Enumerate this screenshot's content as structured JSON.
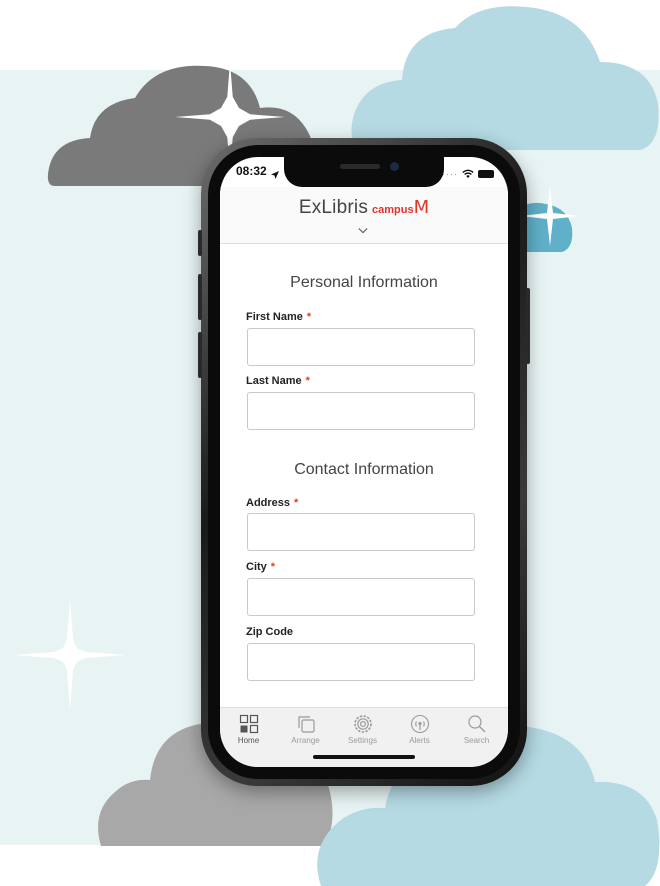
{
  "status_bar": {
    "time": "08:32"
  },
  "header": {
    "logo_ex": "ExLibris",
    "logo_campus": "campus",
    "logo_m": "M"
  },
  "form": {
    "personal_title": "Personal Information",
    "contact_title": "Contact Information",
    "required_marker": "*",
    "fields": [
      {
        "label": "First Name",
        "value": "",
        "required": true
      },
      {
        "label": "Last Name",
        "value": "",
        "required": true
      },
      {
        "label": "Address",
        "value": "",
        "required": true
      },
      {
        "label": "City",
        "value": "",
        "required": true
      },
      {
        "label": "Zip Code",
        "value": "",
        "required": false
      }
    ]
  },
  "tabs": [
    {
      "label": "Home",
      "icon": "home-grid-icon",
      "active": true
    },
    {
      "label": "Arrange",
      "icon": "arrange-icon",
      "active": false
    },
    {
      "label": "Settings",
      "icon": "gear-icon",
      "active": false
    },
    {
      "label": "Alerts",
      "icon": "broadcast-icon",
      "active": false
    },
    {
      "label": "Search",
      "icon": "search-icon",
      "active": false
    }
  ],
  "colors": {
    "accent": "#e0342b",
    "required": "#d8431f",
    "cloud_gray": "#7a7a7a",
    "cloud_blue": "#b5dae4",
    "background_panel": "#e8f4f4"
  }
}
